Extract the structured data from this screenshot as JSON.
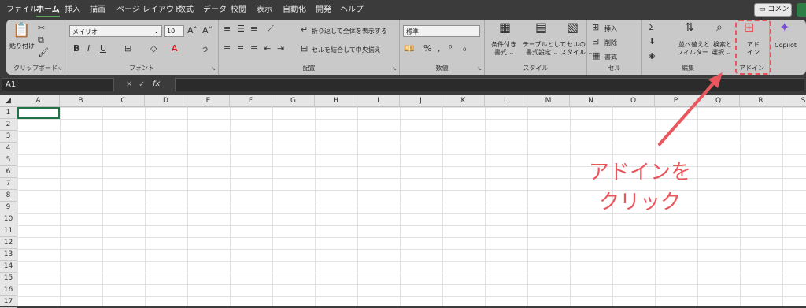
{
  "menu_tabs": [
    "ファイル",
    "ホーム",
    "挿入",
    "描画",
    "ページ レイアウト",
    "数式",
    "データ",
    "校閲",
    "表示",
    "自動化",
    "開発",
    "ヘルプ"
  ],
  "comment_label": "コメント",
  "clipboard": {
    "paste": "貼り付け",
    "label": "クリップボード"
  },
  "font": {
    "name": "メイリオ",
    "size": "10",
    "label": "フォント"
  },
  "alignment": {
    "wrap": "折り返して全体を表示する",
    "merge": "セルを結合して中央揃え",
    "label": "配置"
  },
  "number": {
    "format": "標準",
    "label": "数値"
  },
  "styles": {
    "cond": "条件付き書式",
    "table": "テーブルとして書式設定",
    "cell": "セルのスタイル",
    "cond_l1": "条件付き",
    "cond_l2": "書式 ⌄",
    "table_l1": "テーブルとして",
    "table_l2": "書式設定 ⌄",
    "cell_l1": "セルの",
    "cell_l2": "スタイル ⌄",
    "label": "スタイル"
  },
  "cells": {
    "insert": "挿入",
    "delete": "削除",
    "format": "書式",
    "label": "セル"
  },
  "editing": {
    "sort_l1": "並べ替えと",
    "sort_l2": "フィルター ⌄",
    "find_l1": "検索と",
    "find_l2": "選択 ⌄",
    "label": "編集"
  },
  "addins": {
    "l1": "アド",
    "l2": "イン",
    "label": "アドイン"
  },
  "copilot": {
    "label": "Copilot"
  },
  "formula_bar": {
    "cell_ref": "A1",
    "fx": "fx"
  },
  "columns": [
    "A",
    "B",
    "C",
    "D",
    "E",
    "F",
    "G",
    "H",
    "I",
    "J",
    "K",
    "L",
    "M",
    "N",
    "O",
    "P",
    "Q",
    "R",
    "S"
  ],
  "rows": [
    "1",
    "2",
    "3",
    "4",
    "5",
    "6",
    "7",
    "8",
    "9",
    "10",
    "11",
    "12",
    "13",
    "14",
    "15",
    "16",
    "17"
  ],
  "annotation": {
    "line1": "アドインを",
    "line2": "クリック",
    "color": "#e8575e"
  }
}
